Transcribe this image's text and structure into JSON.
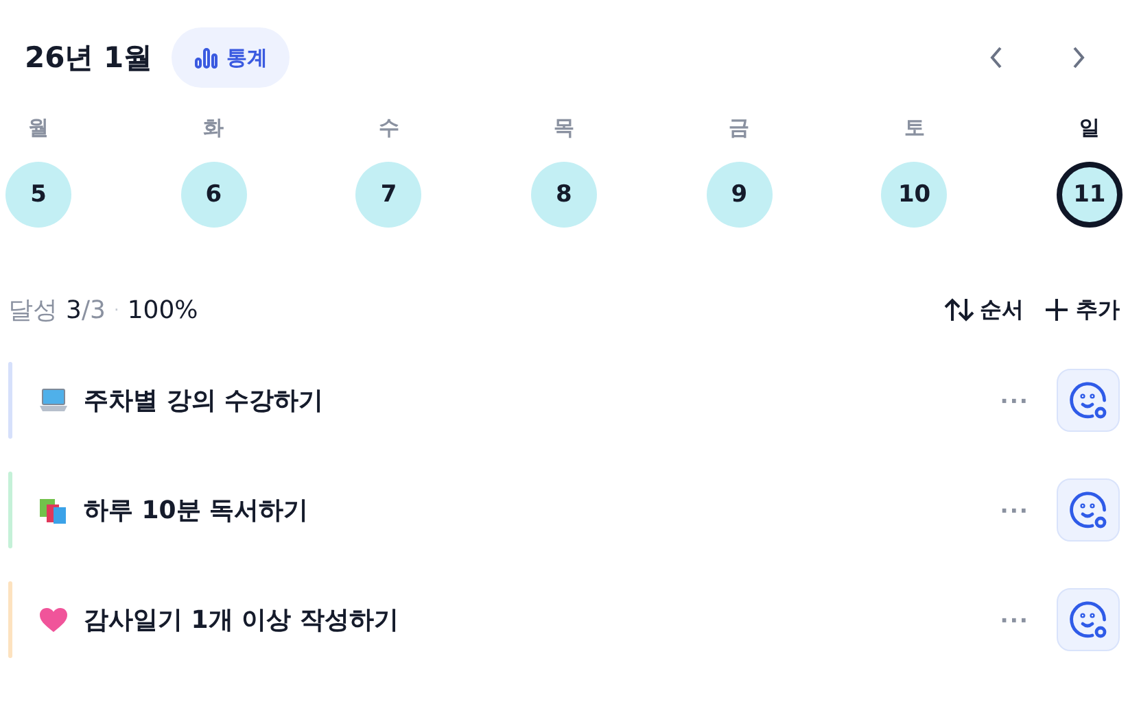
{
  "header": {
    "title": "26년 1월",
    "stats_button": "통계"
  },
  "week": [
    {
      "weekday": "월",
      "day": "5",
      "selected": false
    },
    {
      "weekday": "화",
      "day": "6",
      "selected": false
    },
    {
      "weekday": "수",
      "day": "7",
      "selected": false
    },
    {
      "weekday": "목",
      "day": "8",
      "selected": false
    },
    {
      "weekday": "금",
      "day": "9",
      "selected": false
    },
    {
      "weekday": "토",
      "day": "10",
      "selected": false
    },
    {
      "weekday": "일",
      "day": "11",
      "selected": true
    }
  ],
  "summary": {
    "label": "달성",
    "done": "3",
    "total": "/3",
    "separator": "·",
    "percent": "100%"
  },
  "actions": {
    "sort": "순서",
    "add": "추가"
  },
  "tasks": [
    {
      "kind": "laptop",
      "title": "주차별 강의 수강하기",
      "color": "#d6e0fb",
      "more": "···"
    },
    {
      "kind": "books",
      "title": "하루 10분 독서하기",
      "color": "#c5f1d8",
      "more": "···"
    },
    {
      "kind": "heart",
      "title": "감사일기 1개 이상 작성하기",
      "color": "#fde2bf",
      "more": "···"
    }
  ]
}
